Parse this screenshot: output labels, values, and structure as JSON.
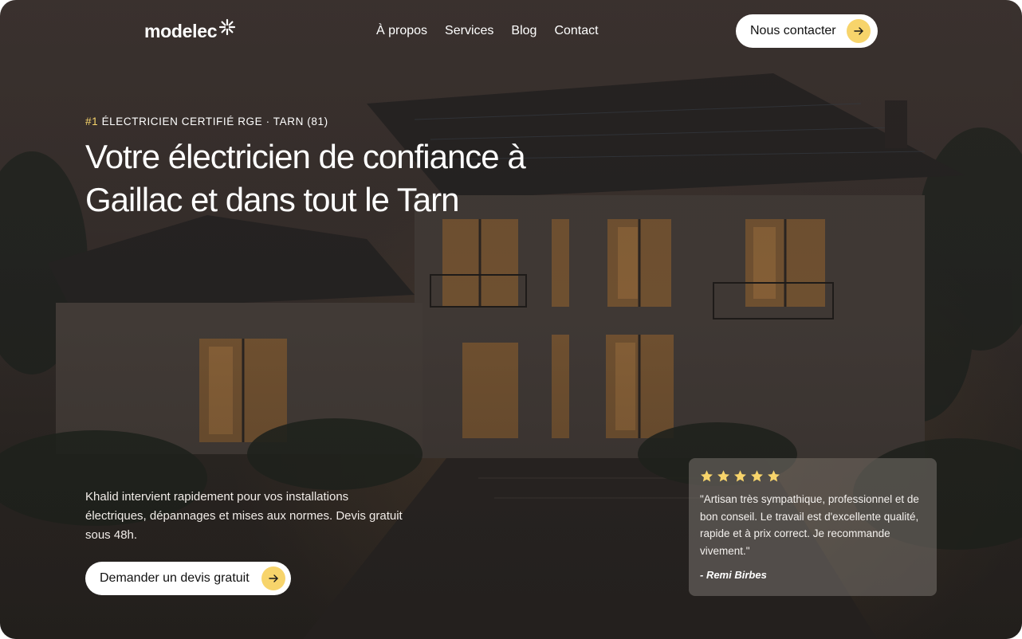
{
  "brand": {
    "name": "modelec"
  },
  "nav": {
    "items": [
      {
        "label": "À propos"
      },
      {
        "label": "Services"
      },
      {
        "label": "Blog"
      },
      {
        "label": "Contact"
      }
    ],
    "contact_button": "Nous contacter"
  },
  "hero": {
    "eyebrow_highlight": "#1",
    "eyebrow_text": "ÉLECTRICIEN CERTIFIÉ RGE · TARN (81)",
    "headline_line1": "Votre électricien de confiance à",
    "headline_line2": "Gaillac et dans tout le Tarn",
    "intro": "Khalid intervient rapidement pour vos installations électriques, dépannages et mises aux normes. Devis gratuit sous 48h.",
    "cta_button": "Demander un devis gratuit"
  },
  "review": {
    "rating": 5,
    "quote": "\"Artisan très sympathique, professionnel et de bon conseil. Le travail est d'excellente qualité, rapide et à prix correct. Je recommande vivement.\"",
    "author": "- Remi Birbes"
  },
  "icons": {
    "logo_mark": "sparkle-icon",
    "button_arrow": "arrow-right-icon",
    "rating": "star-icon"
  },
  "colors": {
    "accent": "#f7d46b",
    "text_on_dark": "#ffffff",
    "button_bg": "#ffffff"
  }
}
